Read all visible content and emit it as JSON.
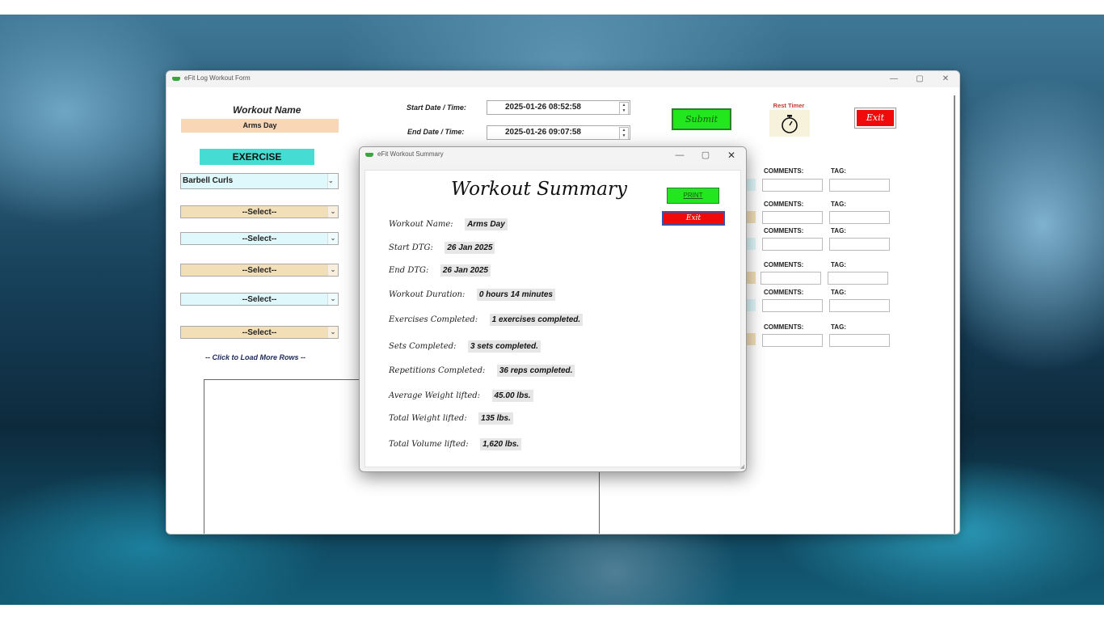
{
  "main_window": {
    "title": "eFit Log Workout Form",
    "minimize": "—",
    "maximize": "▢",
    "close": "✕",
    "workout_name_label": "Workout Name",
    "workout_name_value": "Arms Day",
    "start_label": "Start Date / Time:",
    "start_value": "2025-01-26 08:52:58",
    "end_label": "End Date / Time:",
    "end_value": "2025-01-26 09:07:58",
    "submit_label": "Submit",
    "rest_timer_label": "Rest Timer",
    "exit_label": "Exit",
    "exercise_header": "EXERCISE",
    "exercise_rows": [
      "Barbell Curls",
      "--Select--",
      "--Select--",
      "--Select--",
      "--Select--",
      "--Select--"
    ],
    "load_more": "-- Click to Load More Rows --",
    "comments_label": "COMMENTS:",
    "tag_label": "TAG:"
  },
  "summary_dialog": {
    "title": "eFit Workout Summary",
    "minimize": "—",
    "maximize": "▢",
    "close": "✕",
    "heading": "Workout Summary",
    "print_label": "PRINT",
    "exit_label": "Exit",
    "rows": [
      {
        "label": "Workout Name:",
        "value": "Arms Day"
      },
      {
        "label": "Start DTG:",
        "value": "26 Jan 2025"
      },
      {
        "label": "End DTG:",
        "value": "26 Jan 2025"
      },
      {
        "label": "Workout Duration:",
        "value": "0 hours 14 minutes"
      },
      {
        "label": "Exercises Completed:",
        "value": "1 exercises completed."
      },
      {
        "label": "Sets Completed:",
        "value": "3 sets completed."
      },
      {
        "label": "Repetitions Completed:",
        "value": "36 reps completed."
      },
      {
        "label": "Average Weight lifted:",
        "value": "45.00 lbs."
      },
      {
        "label": "Total Weight lifted:",
        "value": "135 lbs."
      },
      {
        "label": "Total Volume lifted:",
        "value": "1,620 lbs."
      }
    ]
  },
  "colors": {
    "submit_green": "#22e61e",
    "exit_red": "#f00a0a",
    "exercise_header_teal": "#45ddd3",
    "workout_name_tan": "#f9d7b6",
    "row_tan": "#f2dfb8",
    "row_cyan": "#dff8fb",
    "timer_bg": "#f7f2dc"
  },
  "icons": {
    "app": "dumbbell-icon",
    "timer": "stopwatch-icon"
  }
}
